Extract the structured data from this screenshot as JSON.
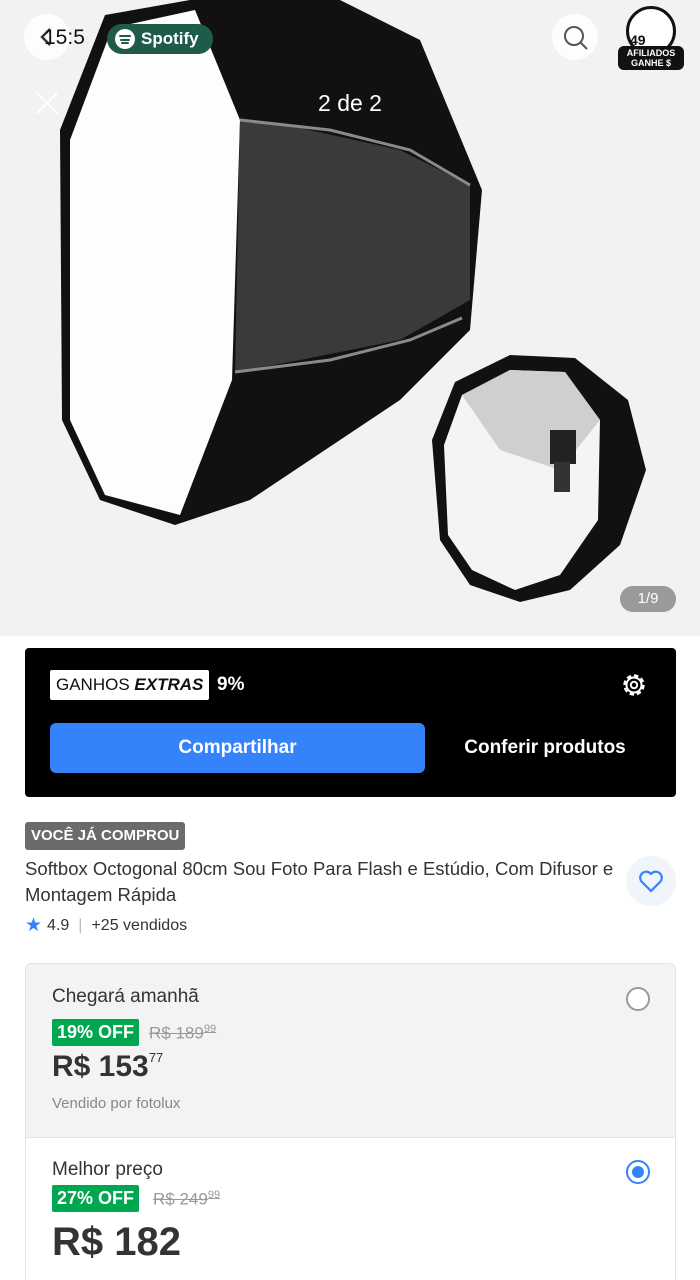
{
  "status": {
    "time": "15:5",
    "battery": "49"
  },
  "spotify": {
    "label": "Spotify"
  },
  "gallery": {
    "overlay_counter": "2 de 2",
    "image_counter": "1/9"
  },
  "affiliate": {
    "label": "AFILIADOS GANHE $"
  },
  "extras": {
    "badge_prefix": "GANHOS",
    "badge_emph": "EXTRAS",
    "percent": "9%",
    "share_label": "Compartilhar",
    "check_label": "Conferir produtos"
  },
  "product": {
    "bought_badge": "VOCÊ JÁ COMPROU",
    "title": "Softbox Octogonal 80cm Sou Foto Para Flash e Estúdio, Com Difusor e Montagem Rápida",
    "rating": "4.9",
    "sold": "+25 vendidos"
  },
  "offers": [
    {
      "heading": "Chegará amanhã",
      "discount": "19% OFF",
      "old_price": "R$ 189",
      "old_cents": "99",
      "price": "R$ 153",
      "price_cents": "77",
      "seller": "Vendido por fotolux",
      "selected": false
    },
    {
      "heading": "Melhor preço",
      "discount": "27% OFF",
      "old_price": "R$ 249",
      "old_cents": "99",
      "price": "R$ 182",
      "price_cents": "",
      "selected": true
    }
  ],
  "colors": {
    "accent": "#3483fa",
    "discount": "#00a650",
    "spotify": "#1f5b4b"
  },
  "icons": [
    "back-arrow-icon",
    "spotify-icon",
    "close-icon",
    "gear-icon",
    "heart-icon",
    "star-icon"
  ]
}
